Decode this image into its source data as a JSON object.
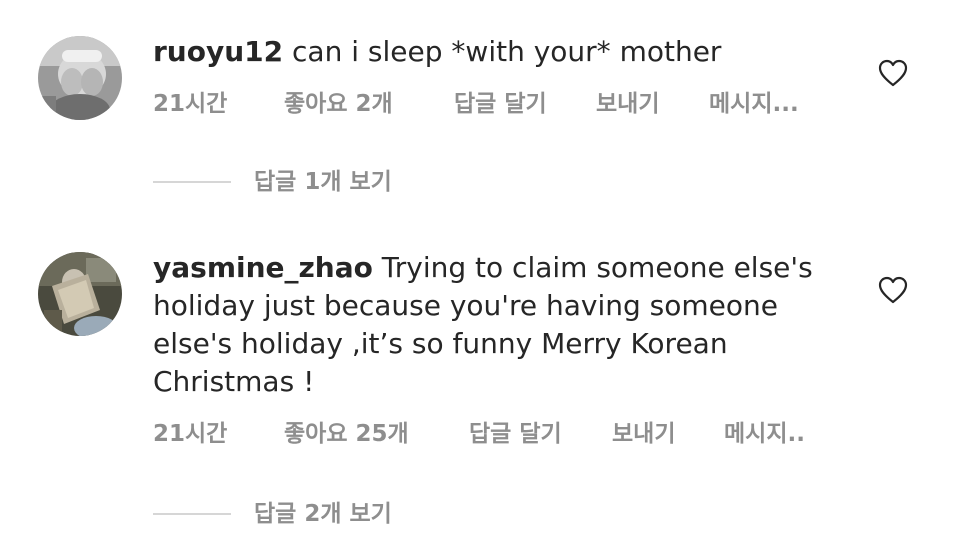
{
  "comments": [
    {
      "username": "ruoyu12",
      "text": " can i sleep *with your* mother",
      "time": "21시간",
      "likes": "좋아요 2개",
      "reply": "답글 달기",
      "send": "보내기",
      "message": "메시지...",
      "view_replies": "답글 1개 보기",
      "avatar_icon": "child-covering-eyes-avatar",
      "heart_icon": "heart-outline-icon"
    },
    {
      "username": "yasmine_zhao",
      "text": " Trying to claim someone else's holiday just because you're having someone else's holiday ,it’s so funny  Merry Korean Christmas !",
      "time": "21시간",
      "likes": "좋아요 25개",
      "reply": "답글 달기",
      "send": "보내기",
      "message": "메시지..",
      "view_replies": "답글 2개 보기",
      "avatar_icon": "person-with-book-avatar",
      "heart_icon": "heart-outline-icon"
    }
  ],
  "colors": {
    "text": "#262626",
    "meta": "#8e8e8e",
    "divider": "#d6d6d6"
  }
}
